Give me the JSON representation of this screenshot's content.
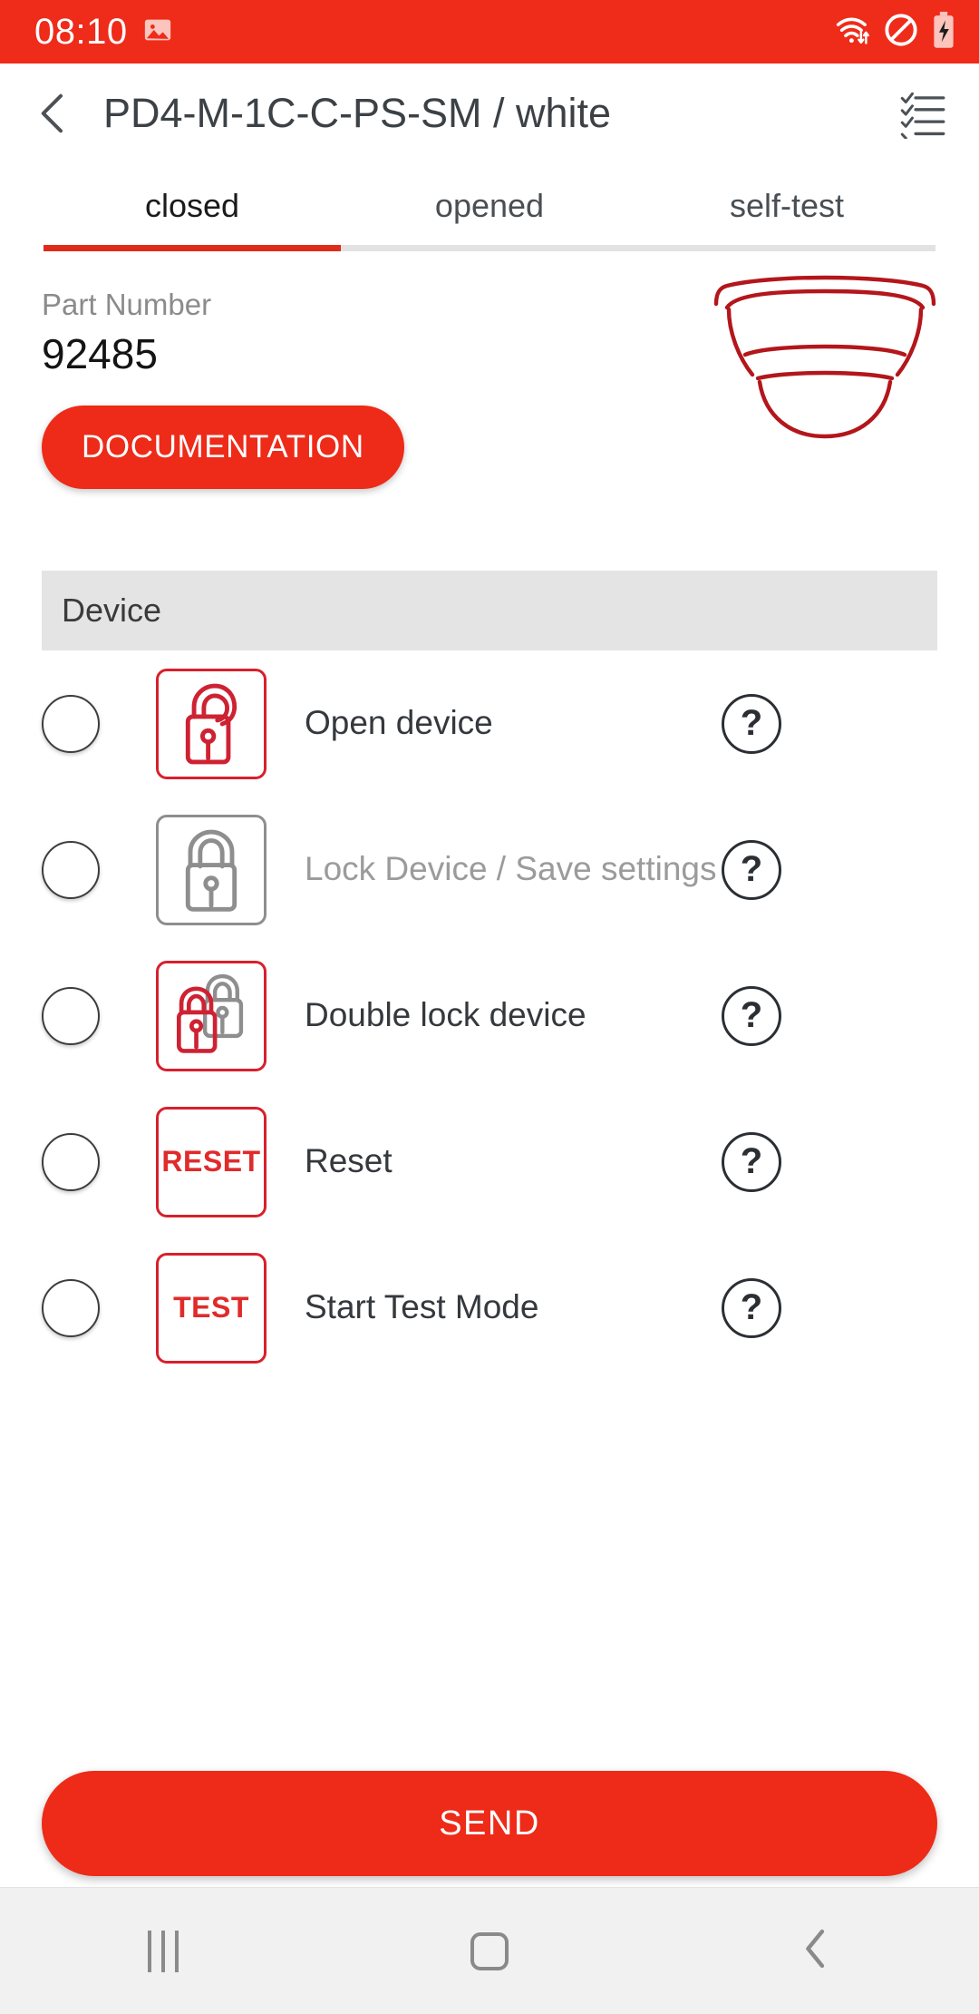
{
  "status_bar": {
    "time": "08:10",
    "left_icons": [
      "image-icon"
    ],
    "right_icons": [
      "wifi-data-icon",
      "do-not-disturb-icon",
      "battery-charging-icon"
    ],
    "background_color": "#EF2B19"
  },
  "app_bar": {
    "back_icon": "chevron-left-icon",
    "title": "PD4-M-1C-C-PS-SM / white",
    "action_icon": "checklist-icon"
  },
  "tabs": {
    "items": [
      {
        "label": "closed",
        "active": true
      },
      {
        "label": "opened",
        "active": false
      },
      {
        "label": "self-test",
        "active": false
      }
    ],
    "indicator_color": "#E02B1B",
    "track_color": "#E2E2E2"
  },
  "product": {
    "part_number_label": "Part Number",
    "part_number_value": "92485",
    "documentation_button": "DOCUMENTATION",
    "art_icon": "ceiling-presence-detector-icon",
    "art_color": "#B3161B",
    "accent_color": "#EE2A18"
  },
  "section": {
    "title": "Device"
  },
  "commands": [
    {
      "label": "Open device",
      "icon": "padlock-open-icon",
      "icon_style": "red",
      "disabled": false,
      "selected": false,
      "help": "?"
    },
    {
      "label": "Lock Device / Save settings",
      "icon": "padlock-closed-icon",
      "icon_style": "gray",
      "disabled": true,
      "selected": false,
      "help": "?"
    },
    {
      "label": "Double lock device",
      "icon": "double-padlock-icon",
      "icon_style": "red",
      "disabled": false,
      "selected": false,
      "help": "?"
    },
    {
      "label": "Reset",
      "icon": "reset-text-icon",
      "icon_text": "RESET",
      "icon_style": "red",
      "disabled": false,
      "selected": false,
      "help": "?"
    },
    {
      "label": "Start Test Mode",
      "icon": "test-text-icon",
      "icon_text": "TEST",
      "icon_style": "red",
      "disabled": false,
      "selected": false,
      "help": "?"
    }
  ],
  "footer": {
    "send_label": "SEND"
  },
  "nav_bar": {
    "recents_icon": "recents-icon",
    "home_icon": "home-square-icon",
    "back_icon": "chevron-left-icon"
  }
}
